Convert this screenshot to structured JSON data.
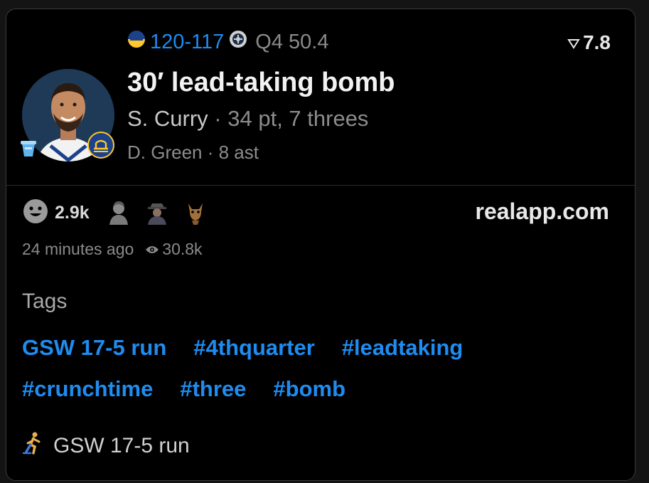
{
  "header": {
    "score": "120-117",
    "quarter": "Q4 50.4",
    "rating": "7.8",
    "title": "30′ lead-taking bomb",
    "player": "S. Curry",
    "player_stats": "34 pt, 7 threes",
    "assist_player": "D. Green",
    "assist_stats": "8 ast",
    "separator": " · "
  },
  "engagement": {
    "reaction_count": "2.9k",
    "site": "realapp.com",
    "posted": "24 minutes ago",
    "views": "30.8k"
  },
  "tags": {
    "label": "Tags",
    "row1": [
      "GSW 17-5 run",
      "#4thquarter",
      "#leadtaking"
    ],
    "row2": [
      "#crunchtime",
      "#three",
      "#bomb"
    ]
  },
  "run": {
    "label": "GSW 17-5 run"
  },
  "colors": {
    "accent": "#1e8cf0",
    "background": "#000000",
    "warriors_blue": "#1d428a",
    "warriors_gold": "#ffc72c"
  },
  "icons": {
    "team_left": "warriors-logo-icon",
    "team_right": "opponent-logo-icon",
    "rating": "triangle-down-icon",
    "reaction": "smiley-icon",
    "views": "eye-icon",
    "run": "running-person-icon",
    "cup": "cup-icon"
  }
}
